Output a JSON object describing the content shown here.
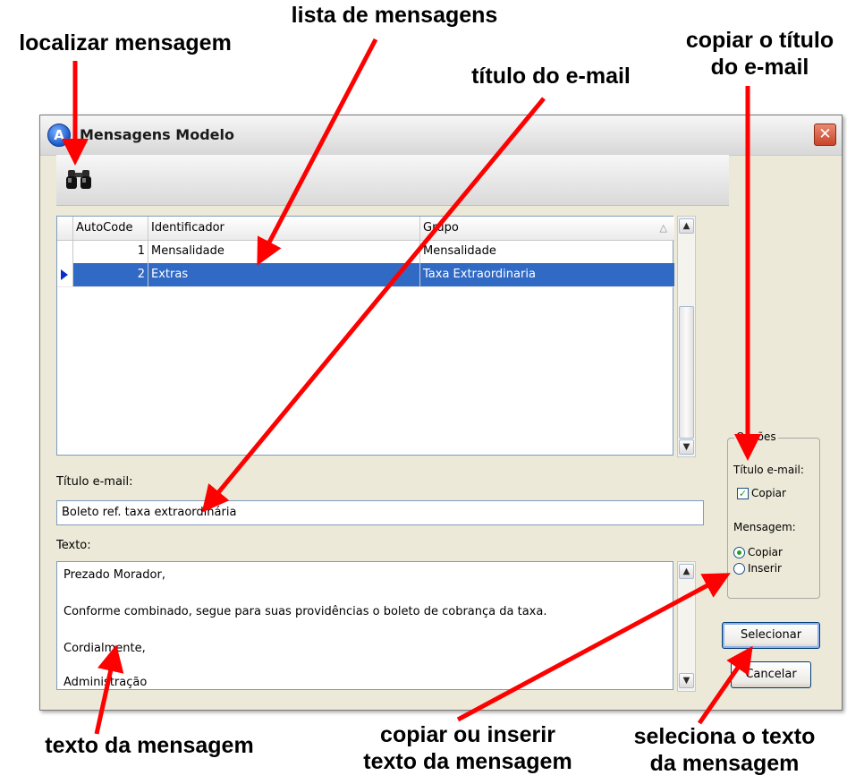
{
  "annotations": {
    "find_message": "localizar mensagem",
    "message_list": "lista de mensagens",
    "email_title": "título do e-mail",
    "copy_title": [
      "copiar o título",
      "do e-mail"
    ],
    "message_text": "texto da mensagem",
    "copy_insert": [
      "copiar ou inserir",
      "texto da mensagem"
    ],
    "select_text": [
      "seleciona o texto",
      "da mensagem"
    ]
  },
  "window": {
    "title": "Mensagens Modelo",
    "close_glyph": "✕",
    "app_icon_letter": "A"
  },
  "toolbar": {
    "find_icon": "binoculars-icon"
  },
  "grid": {
    "columns": [
      "AutoCode",
      "Identificador",
      "Grupo"
    ],
    "sort_glyph": "△",
    "rows": [
      {
        "autocode": "1",
        "identificador": "Mensalidade",
        "grupo": "Mensalidade",
        "selected": false
      },
      {
        "autocode": "2",
        "identificador": "Extras",
        "grupo": "Taxa Extraordinaria",
        "selected": true
      }
    ]
  },
  "title_field": {
    "label": "Título e-mail:",
    "value": "Boleto ref. taxa extraordinária"
  },
  "text_field": {
    "label": "Texto:",
    "lines": [
      "Prezado Morador,",
      "Conforme combinado, segue para suas providências o boleto de cobrança da taxa.",
      "Cordialmente,",
      "Administração"
    ]
  },
  "options": {
    "group_title": "Opções",
    "title_label": "Título e-mail:",
    "title_copy_label": "Copiar",
    "title_copy_checked": true,
    "message_label": "Mensagem:",
    "message_copy_label": "Copiar",
    "message_insert_label": "Inserir",
    "message_mode": "copy"
  },
  "buttons": {
    "select": "Selecionar",
    "cancel": "Cancelar"
  },
  "colors": {
    "selection": "#316ac5",
    "arrow": "#ff0000",
    "window_bg": "#ece9d8"
  }
}
